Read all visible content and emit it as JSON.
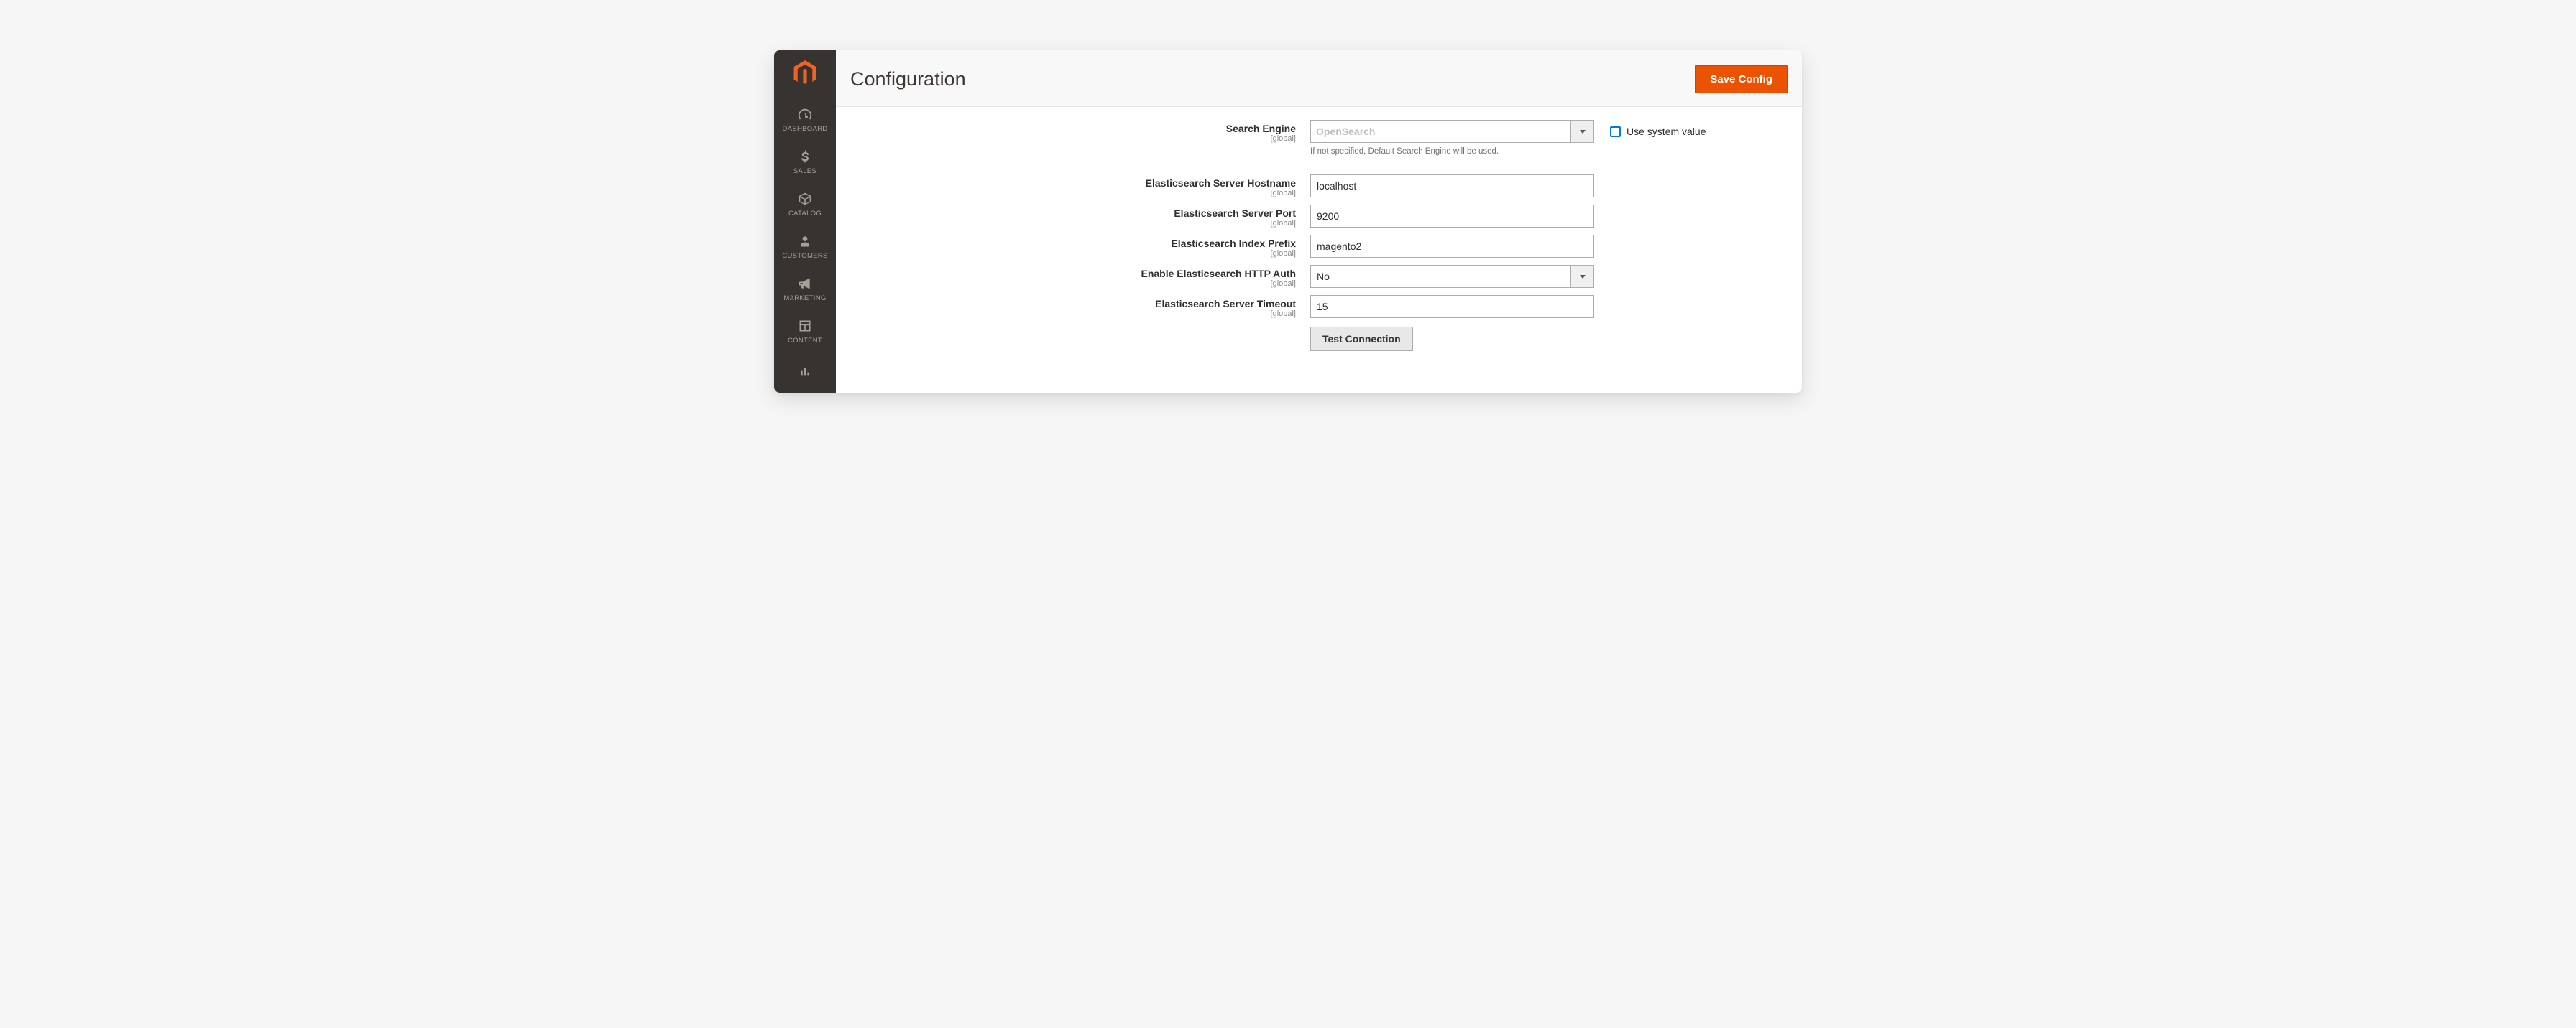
{
  "header": {
    "title": "Configuration",
    "save_button": "Save Config"
  },
  "sidebar": {
    "items": [
      {
        "key": "dashboard",
        "label": "DASHBOARD"
      },
      {
        "key": "sales",
        "label": "SALES"
      },
      {
        "key": "catalog",
        "label": "CATALOG"
      },
      {
        "key": "customers",
        "label": "CUSTOMERS"
      },
      {
        "key": "marketing",
        "label": "MARKETING"
      },
      {
        "key": "content",
        "label": "CONTENT"
      },
      {
        "key": "reports",
        "label": ""
      }
    ]
  },
  "scope_label": "[global]",
  "use_system_value_label": "Use system value",
  "fields": {
    "search_engine": {
      "label": "Search Engine",
      "value": "OpenSearch",
      "helper": "If not specified, Default Search Engine will be used."
    },
    "hostname": {
      "label": "Elasticsearch Server Hostname",
      "value": "localhost"
    },
    "port": {
      "label": "Elasticsearch Server Port",
      "value": "9200"
    },
    "prefix": {
      "label": "Elasticsearch Index Prefix",
      "value": "magento2"
    },
    "httpauth": {
      "label": "Enable Elasticsearch HTTP Auth",
      "value": "No"
    },
    "timeout": {
      "label": "Elasticsearch Server Timeout",
      "value": "15"
    },
    "test_button": "Test Connection"
  }
}
